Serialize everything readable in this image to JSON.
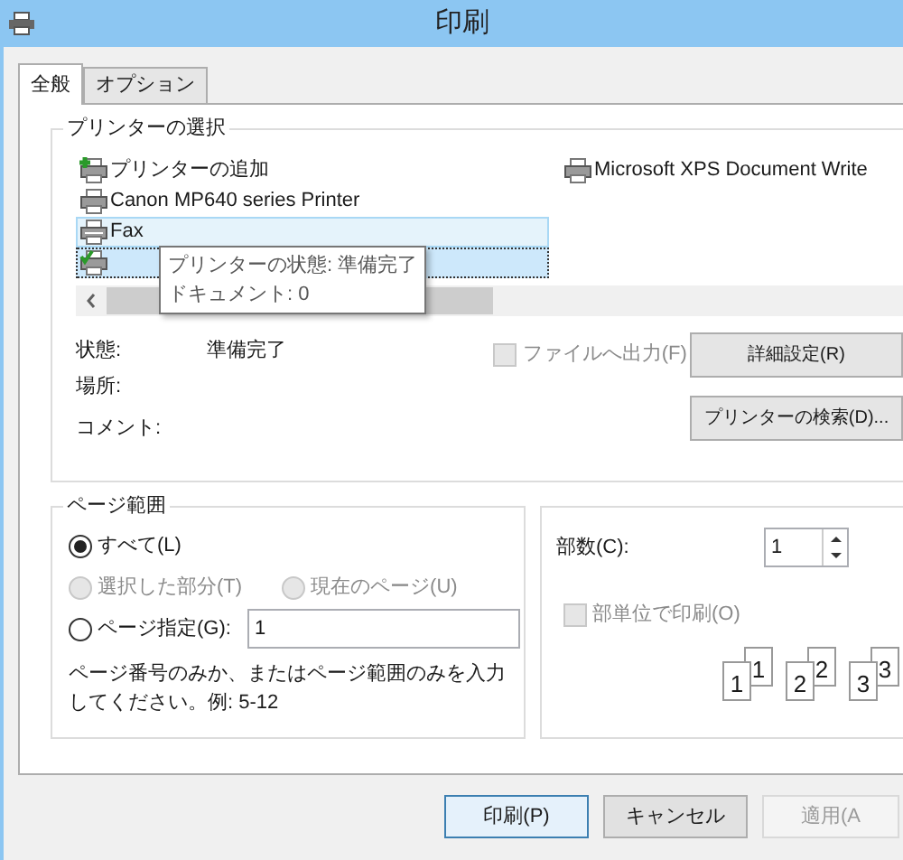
{
  "window": {
    "title": "印刷"
  },
  "tabs": [
    {
      "label": "全般",
      "selected": true
    },
    {
      "label": "オプション",
      "selected": false
    }
  ],
  "printer_select": {
    "title": "プリンターの選択",
    "items": [
      {
        "kind": "add",
        "label": "プリンターの追加",
        "selected": false,
        "focused": false
      },
      {
        "kind": "printer",
        "label": "Canon MP640 series Printer",
        "selected": false,
        "focused": false
      },
      {
        "kind": "fax",
        "label": "Fax",
        "selected": true,
        "focused": false
      },
      {
        "kind": "default",
        "selected": true,
        "focused": true
      },
      {
        "kind": "printer",
        "label": "Microsoft XPS Document Write",
        "selected": false,
        "focused": false
      }
    ],
    "tooltip": [
      "プリンターの状態: 準備完了",
      "ドキュメント: 0"
    ],
    "status_label": "状態:",
    "status_value": "準備完了",
    "location_label": "場所:",
    "comment_label": "コメント:",
    "print_to_file": {
      "label": "ファイルへ出力(F)",
      "checked": false,
      "disabled": true
    },
    "buttons": [
      "詳細設定(R)",
      "プリンターの検索(D)..."
    ]
  },
  "page_range": {
    "title": "ページ範囲",
    "options": [
      {
        "label": "すべて(L)",
        "selected": true,
        "disabled": false
      },
      {
        "label": "選択した部分(T)",
        "selected": false,
        "disabled": true
      },
      {
        "label": "現在のページ(U)",
        "selected": false,
        "disabled": true
      },
      {
        "label": "ページ指定(G):",
        "selected": false,
        "disabled": false
      }
    ],
    "pages_value": "1",
    "hint": "ページ番号のみか、またはページ範囲のみを入力してください。例: 5-12"
  },
  "copies": {
    "label": "部数(C):",
    "value": "1",
    "collate": {
      "label": "部単位で印刷(O)",
      "checked": false,
      "disabled": true
    },
    "pages": [
      "1",
      "1",
      "2",
      "2",
      "3",
      "3"
    ]
  },
  "buttons": [
    {
      "label": "印刷(P)",
      "disabled": false,
      "default": true
    },
    {
      "label": "キャンセル",
      "disabled": false,
      "default": false
    },
    {
      "label": "適用(A",
      "disabled": true,
      "default": false
    }
  ]
}
